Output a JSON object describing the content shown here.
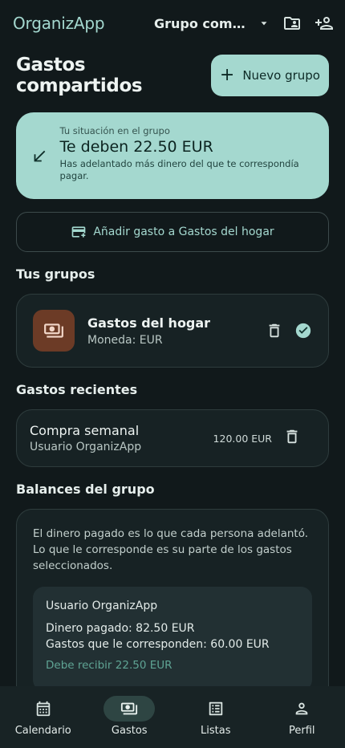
{
  "app": {
    "name": "OrganizApp",
    "group_selector": "Grupo compartido",
    "icons": [
      "chevron-down-icon",
      "folder-share-icon",
      "person-add-icon"
    ]
  },
  "header": {
    "title": "Gastos compartidos",
    "new_group_label": "Nuevo grupo"
  },
  "situation": {
    "label": "Tu situación en el grupo",
    "amount_text": "Te deben 22.50 EUR",
    "description": "Has adelantado más dinero del que te correspondía pagar."
  },
  "add_expense_label": "Añadir gasto a Gastos del hogar",
  "groups": {
    "title": "Tus grupos",
    "items": [
      {
        "name": "Gastos del hogar",
        "currency": "Moneda: EUR"
      }
    ]
  },
  "recent": {
    "title": "Gastos recientes",
    "items": [
      {
        "title": "Compra semanal",
        "user": "Usuario OrganizApp",
        "amount": "120.00 EUR"
      }
    ]
  },
  "balances": {
    "title": "Balances del grupo",
    "description": "El dinero pagado es lo que cada persona adelantó. Lo que le corresponde es su parte de los gastos seleccionados.",
    "members": [
      {
        "name": "Usuario OrganizApp",
        "paid": "Dinero pagado: 82.50 EUR",
        "owed": "Gastos que le corresponden: 60.00 EUR",
        "status": "Debe recibir 22.50 EUR"
      }
    ]
  },
  "nav": {
    "items": [
      {
        "label": "Calendario",
        "icon": "calendar-icon"
      },
      {
        "label": "Gastos",
        "icon": "money-icon",
        "active": true
      },
      {
        "label": "Listas",
        "icon": "list-icon"
      },
      {
        "label": "Perfil",
        "icon": "person-icon"
      }
    ]
  },
  "colors": {
    "background": "#11191b",
    "accent": "#a4d8cf",
    "avatar": "#6c3b26",
    "success_text": "#5fa494"
  }
}
